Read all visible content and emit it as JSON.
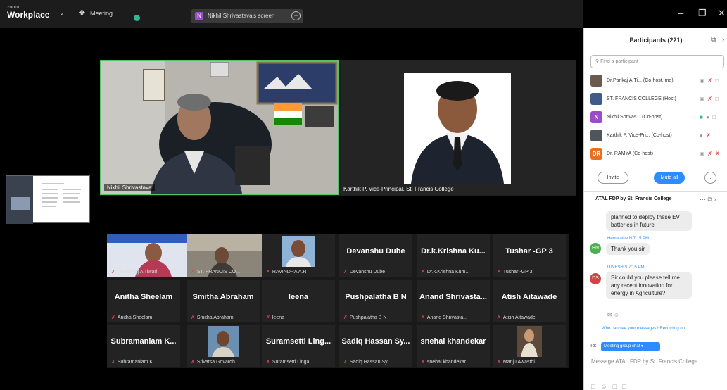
{
  "titlebar": {
    "brand_small": "zoom",
    "brand_big": "Workplace",
    "meeting_label": "Meeting",
    "share_badge": "N",
    "share_text": "Nikhil Shrivastava's screen"
  },
  "speakers": [
    {
      "label": "Nikhil Shrivastava"
    },
    {
      "label": "Karthik P, Vice-Principal, St. Francis College"
    }
  ],
  "gallery": [
    {
      "name": "",
      "label": "Dr.Pankaj A Tiwari",
      "photo": true
    },
    {
      "name": "",
      "label": "ST. FRANCIS CO...",
      "photo": true
    },
    {
      "name": "",
      "label": "RAVINDRA A.R",
      "photo": true
    },
    {
      "name": "Devanshu Dube",
      "label": "Devanshu Dube"
    },
    {
      "name": "Dr.k.Krishna Ku...",
      "label": "Dr.k.Krishna Kum..."
    },
    {
      "name": "Tushar -GP 3",
      "label": "Tushar -GP 3"
    },
    {
      "name": "Anitha Sheelam",
      "label": "Anitha Sheelam"
    },
    {
      "name": "Smitha Abraham",
      "label": "Smitha Abraham"
    },
    {
      "name": "leena",
      "label": "leena"
    },
    {
      "name": "Pushpalatha B N",
      "label": "Pushpalatha B N"
    },
    {
      "name": "Anand Shrivasta...",
      "label": "Anand Shrivasta..."
    },
    {
      "name": "Atish Aitawade",
      "label": "Atish Aitawade"
    },
    {
      "name": "Subramaniam K...",
      "label": "Subramaniam K..."
    },
    {
      "name": "",
      "label": "Srivatsa Govardh...",
      "photo": true
    },
    {
      "name": "Suramsetti Ling...",
      "label": "Suramsetti Linga..."
    },
    {
      "name": "Sadiq Hassan Sy...",
      "label": "Sadiq Hassan Sy..."
    },
    {
      "name": "snehal khandekar",
      "label": "snehal khandekar"
    },
    {
      "name": "",
      "label": "Manju Awasthi",
      "photo": true
    }
  ],
  "participants": {
    "title": "Participants (221)",
    "search_placeholder": "Find a participant",
    "rows": [
      {
        "avatar": "",
        "name": "Dr.Pankaj A.Ti... (Co-host, me)",
        "color": "#6b5a4e"
      },
      {
        "avatar": "",
        "name": "ST. FRANCIS COLLEGE (Host)",
        "color": "#3f5b8a"
      },
      {
        "avatar": "N",
        "name": "Nikhil Shrivas... (Co-host)",
        "color": "#9b4dc9"
      },
      {
        "avatar": "",
        "name": "Karthik P, Vice-Pri... (Co-host)",
        "color": "#50555c"
      },
      {
        "avatar": "DR",
        "name": "Dr. RAMYA (Co-host)",
        "color": "#e87022"
      }
    ],
    "invite_label": "Invite",
    "mute_all_label": "Mute all",
    "more_label": "..."
  },
  "chat": {
    "title": "ATAL FDP by St. Francis College",
    "messages": [
      {
        "text": "planned to deploy these EV batteries in future"
      },
      {
        "meta": "Hemalatha N 7:15 PM",
        "avatar": "HN",
        "color": "#4caf50",
        "text": "Thank you sir"
      },
      {
        "meta": "DINESH S 7:15 PM",
        "avatar": "DS",
        "color": "#d04444",
        "text": "Sir could you please tell me any recent innovation for energy in Agriculture?"
      }
    ],
    "who_can_see": "Who can see your messages? Recording on",
    "to_label": "To:",
    "to_value": "Meeting group chat",
    "input_placeholder": "Message ATAL FDP by St. Francis College"
  }
}
